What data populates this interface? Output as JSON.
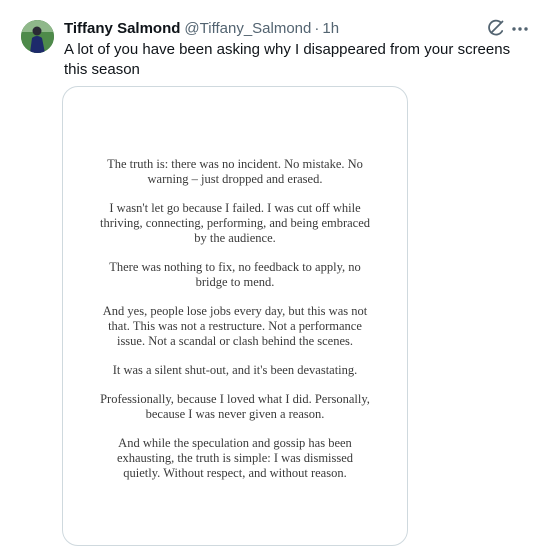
{
  "tweet": {
    "author": {
      "display_name": "Tiffany Salmond",
      "handle": "@Tiffany_Salmond",
      "separator": "·",
      "timestamp": "1h"
    },
    "text": "A lot of you have been asking why I disappeared from your screens this season",
    "icons": {
      "grok": "grok-icon",
      "more": "more-icon"
    },
    "image_text": {
      "paragraphs": [
        "The truth is: there was no incident. No mistake. No warning – just dropped and erased.",
        "I wasn't let go because I failed. I was cut off while thriving, connecting, performing, and being embraced by the audience.",
        "There was nothing to fix, no feedback to apply, no bridge to mend.",
        "And yes, people lose jobs every day, but this was not that. This was not a restructure. Not a performance issue. Not a scandal or clash behind the scenes.",
        "It was a silent shut-out, and it's been devastating.",
        "Professionally, because I loved what I did. Personally, because I was never given a reason.",
        "And while the speculation and gossip has been exhausting, the truth is simple: I was dismissed quietly. Without respect, and without reason."
      ]
    }
  }
}
